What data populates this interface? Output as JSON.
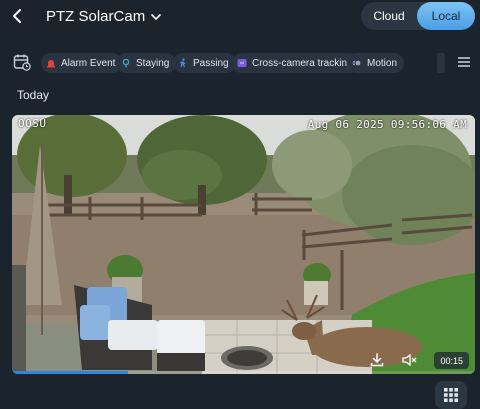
{
  "header": {
    "title": "PTZ SolarCam",
    "modes": [
      {
        "label": "Cloud",
        "selected": false
      },
      {
        "label": "Local",
        "selected": true
      }
    ]
  },
  "filters": {
    "items": [
      {
        "label": "Alarm Event",
        "icon": "alarm-icon",
        "color": "#e0453c"
      },
      {
        "label": "Staying",
        "icon": "staying-icon",
        "color": "#3aa3c9"
      },
      {
        "label": "Passing",
        "icon": "passing-icon",
        "color": "#4a8fe8"
      },
      {
        "label": "Cross-camera tracking",
        "icon": "cross-camera-icon",
        "color": "#7a5ce0"
      },
      {
        "label": "Motion",
        "icon": "motion-icon",
        "color": "#8fa4c0"
      }
    ]
  },
  "section": {
    "label": "Today"
  },
  "video": {
    "osd_left": "OOSU",
    "timestamp": "Aug 06 2025 09:56:06 AM",
    "duration": "00:15",
    "progress": 0.25
  },
  "colors": {
    "accent": "#4a9fe6",
    "background": "#1b232d"
  }
}
